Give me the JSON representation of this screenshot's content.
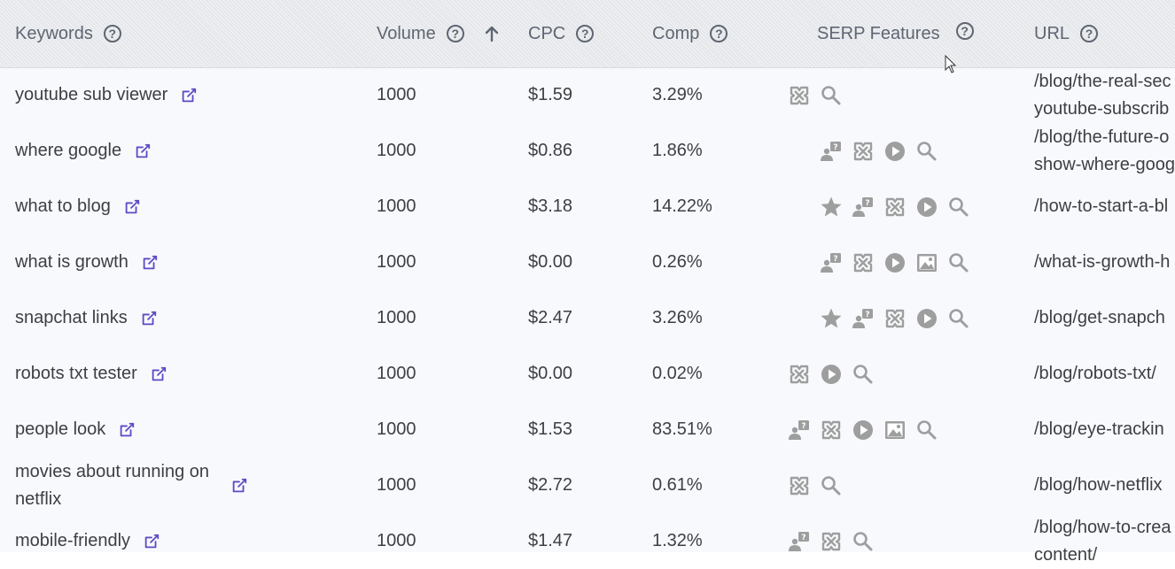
{
  "header": {
    "keywords": "Keywords",
    "volume": "Volume",
    "cpc": "CPC",
    "comp": "Comp",
    "serp": "SERP Features",
    "url": "URL",
    "help": "?"
  },
  "rows": [
    {
      "keyword": "youtube sub viewer",
      "volume": "1000",
      "cpc": "$1.59",
      "comp": "3.29%",
      "features": [
        "sitelinks-icon",
        "search-icon"
      ],
      "url": "/blog/the-real-sec\nyoutube-subscrib"
    },
    {
      "keyword": "where google",
      "volume": "1000",
      "cpc": "$0.86",
      "comp": "1.86%",
      "features": [
        "people-also-ask-icon",
        "sitelinks-icon",
        "video-icon",
        "search-icon"
      ],
      "url": "/blog/the-future-o\nshow-where-goog"
    },
    {
      "keyword": "what to blog",
      "volume": "1000",
      "cpc": "$3.18",
      "comp": "14.22%",
      "features": [
        "star-icon",
        "people-also-ask-icon",
        "sitelinks-icon",
        "video-icon",
        "search-icon"
      ],
      "url": "/how-to-start-a-bl"
    },
    {
      "keyword": "what is growth",
      "volume": "1000",
      "cpc": "$0.00",
      "comp": "0.26%",
      "features": [
        "people-also-ask-icon",
        "sitelinks-icon",
        "video-icon",
        "image-icon",
        "search-icon"
      ],
      "url": "/what-is-growth-h"
    },
    {
      "keyword": "snapchat links",
      "volume": "1000",
      "cpc": "$2.47",
      "comp": "3.26%",
      "features": [
        "star-icon",
        "people-also-ask-icon",
        "sitelinks-icon",
        "video-icon",
        "search-icon"
      ],
      "url": "/blog/get-snapch"
    },
    {
      "keyword": "robots txt tester",
      "volume": "1000",
      "cpc": "$0.00",
      "comp": "0.02%",
      "features": [
        "sitelinks-icon",
        "video-icon",
        "search-icon"
      ],
      "url": "/blog/robots-txt/"
    },
    {
      "keyword": "people look",
      "volume": "1000",
      "cpc": "$1.53",
      "comp": "83.51%",
      "features": [
        "people-also-ask-icon",
        "sitelinks-icon",
        "video-icon",
        "image-icon",
        "search-icon"
      ],
      "url": "/blog/eye-trackin"
    },
    {
      "keyword": "movies about running on\nnetflix",
      "volume": "1000",
      "cpc": "$2.72",
      "comp": "0.61%",
      "features": [
        "sitelinks-icon",
        "search-icon"
      ],
      "url": "/blog/how-netflix"
    },
    {
      "keyword": "mobile-friendly",
      "volume": "1000",
      "cpc": "$1.47",
      "comp": "1.32%",
      "features": [
        "people-also-ask-icon",
        "sitelinks-icon",
        "search-icon"
      ],
      "url": "/blog/how-to-crea\ncontent/"
    }
  ],
  "colors": {
    "link_icon": "#5b4bc4",
    "feature_icon": "#9e9e9e",
    "header_text": "#5f6672"
  }
}
